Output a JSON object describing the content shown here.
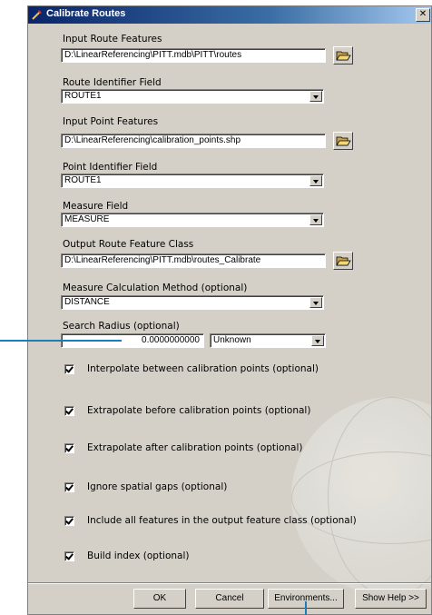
{
  "window": {
    "title": "Calibrate Routes",
    "close_label": "✕"
  },
  "fields": [
    {
      "label": "Input Route Features",
      "value": "D:\\LinearReferencing\\PITT.mdb\\PITT\\routes",
      "type": "path"
    },
    {
      "label": "Route Identifier Field",
      "value": "ROUTE1",
      "type": "dropdown"
    },
    {
      "label": "Input Point Features",
      "value": "D:\\LinearReferencing\\calibration_points.shp",
      "type": "path"
    },
    {
      "label": "Point Identifier Field",
      "value": "ROUTE1",
      "type": "dropdown"
    },
    {
      "label": "Measure Field",
      "value": "MEASURE",
      "type": "dropdown"
    },
    {
      "label": "Output Route Feature Class",
      "value": "D:\\LinearReferencing\\PITT.mdb\\routes_Calibrate",
      "type": "path"
    },
    {
      "label": "Measure Calculation Method (optional)",
      "value": "DISTANCE",
      "type": "dropdown"
    }
  ],
  "search_radius": {
    "label": "Search Radius (optional)",
    "value": "0.0000000000",
    "unit": "Unknown"
  },
  "checkboxes": [
    {
      "label": "Interpolate between calibration points (optional)",
      "checked": true
    },
    {
      "label": "Extrapolate before calibration points (optional)",
      "checked": true
    },
    {
      "label": "Extrapolate after calibration points (optional)",
      "checked": true
    },
    {
      "label": "Ignore spatial gaps (optional)",
      "checked": true
    },
    {
      "label": "Include all features in the output feature class (optional)",
      "checked": true
    },
    {
      "label": "Build index (optional)",
      "checked": true
    }
  ],
  "buttons": {
    "ok": "OK",
    "cancel": "Cancel",
    "environments": "Environments...",
    "help": "Show Help >>"
  },
  "colors": {
    "title_start": "#0a246a",
    "title_end": "#a6caf0",
    "callout": "#1a7fb8",
    "dialog_bg": "#d4d0c8"
  },
  "icons": {
    "title": "tool-icon",
    "browse": "folder-open-icon"
  }
}
